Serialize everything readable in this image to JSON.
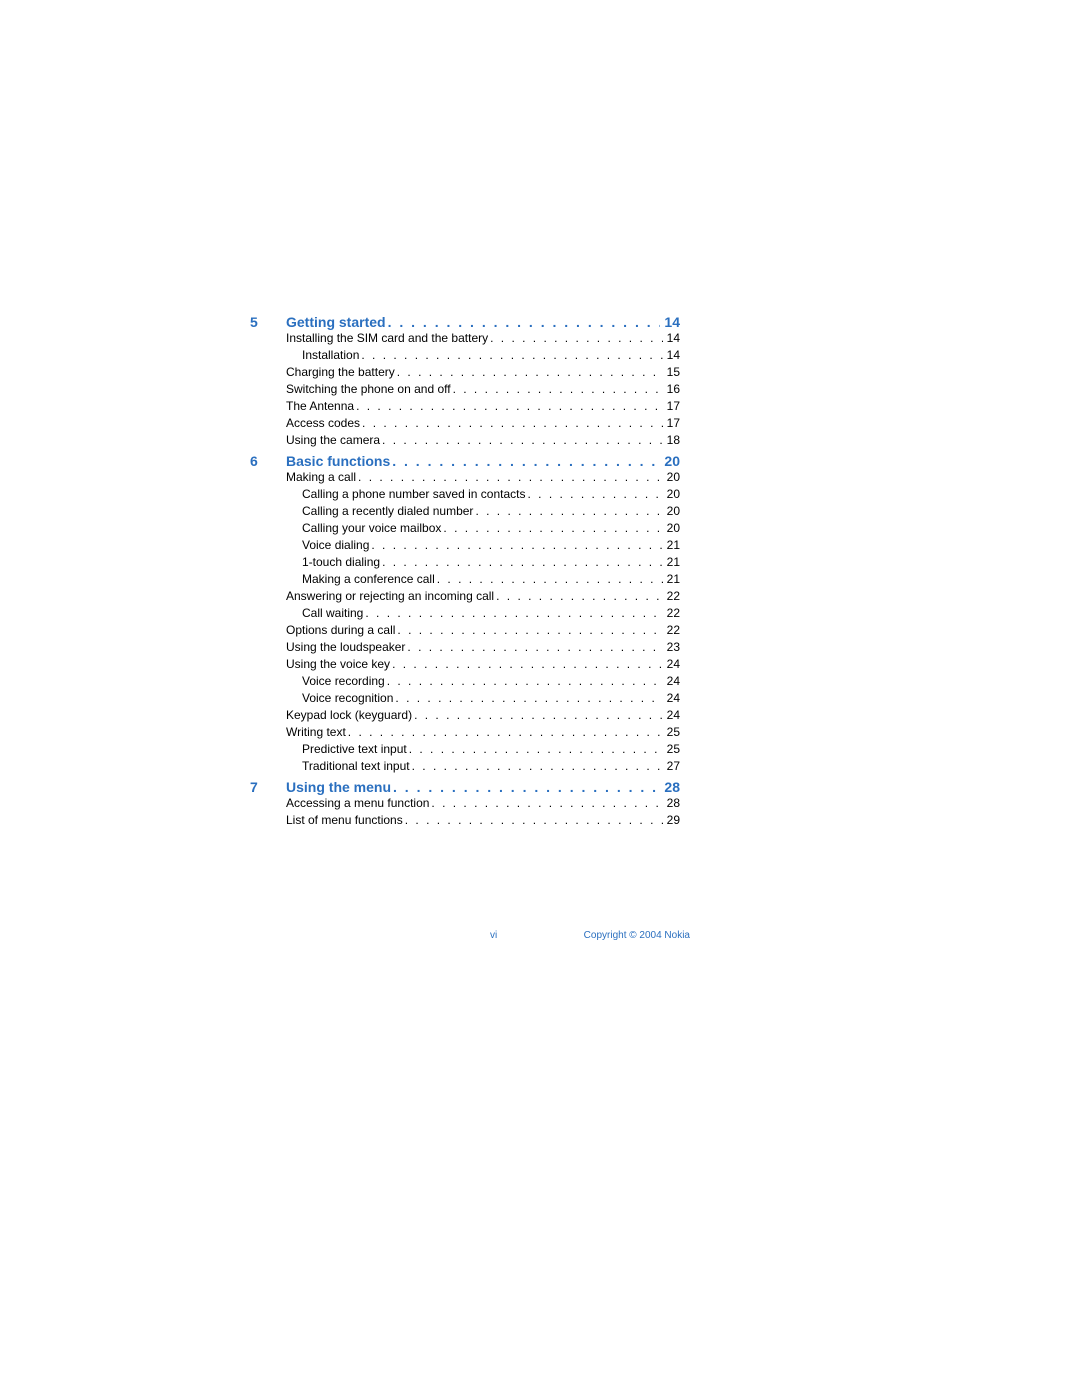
{
  "dots": ". . . . . . . . . . . . . . . . . . . . . . . . . . . . . . . . . . . . . . . . . . . . . . . . . . . . . . . . . . . . . . . . . . . . . .",
  "footer": {
    "page_roman": "vi",
    "copyright": "Copyright © 2004 Nokia"
  },
  "sections": [
    {
      "num": "5",
      "title": "Getting started",
      "page": "14",
      "entries": [
        {
          "lvl": 0,
          "title": "Installing the SIM card and the battery",
          "page": "14"
        },
        {
          "lvl": 1,
          "title": "Installation",
          "page": "14"
        },
        {
          "lvl": 0,
          "title": "Charging the battery",
          "page": "15"
        },
        {
          "lvl": 0,
          "title": "Switching the phone on and off",
          "page": "16"
        },
        {
          "lvl": 0,
          "title": "The Antenna",
          "page": "17"
        },
        {
          "lvl": 0,
          "title": "Access codes",
          "page": "17"
        },
        {
          "lvl": 0,
          "title": "Using the camera",
          "page": "18"
        }
      ]
    },
    {
      "num": "6",
      "title": "Basic functions",
      "page": "20",
      "entries": [
        {
          "lvl": 0,
          "title": "Making a call",
          "page": "20"
        },
        {
          "lvl": 1,
          "title": "Calling a phone number saved in contacts",
          "page": "20"
        },
        {
          "lvl": 1,
          "title": "Calling a recently dialed number",
          "page": "20"
        },
        {
          "lvl": 1,
          "title": "Calling your voice mailbox",
          "page": "20"
        },
        {
          "lvl": 1,
          "title": "Voice dialing",
          "page": "21"
        },
        {
          "lvl": 1,
          "title": "1-touch dialing",
          "page": "21"
        },
        {
          "lvl": 1,
          "title": "Making a conference call",
          "page": "21"
        },
        {
          "lvl": 0,
          "title": "Answering or rejecting an incoming call",
          "page": "22"
        },
        {
          "lvl": 1,
          "title": "Call waiting",
          "page": "22"
        },
        {
          "lvl": 0,
          "title": "Options during a call",
          "page": "22"
        },
        {
          "lvl": 0,
          "title": "Using the loudspeaker",
          "page": "23"
        },
        {
          "lvl": 0,
          "title": "Using the voice key",
          "page": "24"
        },
        {
          "lvl": 1,
          "title": "Voice recording",
          "page": "24"
        },
        {
          "lvl": 1,
          "title": "Voice recognition",
          "page": "24"
        },
        {
          "lvl": 0,
          "title": "Keypad lock (keyguard)",
          "page": "24"
        },
        {
          "lvl": 0,
          "title": "Writing text",
          "page": "25"
        },
        {
          "lvl": 1,
          "title": "Predictive text input",
          "page": "25"
        },
        {
          "lvl": 1,
          "title": "Traditional text input",
          "page": "27"
        }
      ]
    },
    {
      "num": "7",
      "title": "Using the menu",
      "page": "28",
      "entries": [
        {
          "lvl": 0,
          "title": "Accessing a menu function",
          "page": "28"
        },
        {
          "lvl": 0,
          "title": "List of menu functions",
          "page": "29"
        }
      ]
    }
  ]
}
